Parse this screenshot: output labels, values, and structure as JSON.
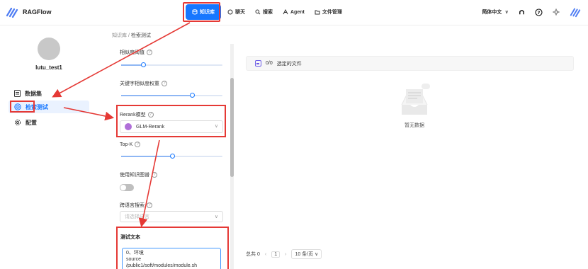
{
  "app": {
    "name": "RAGFlow"
  },
  "nav": {
    "items": [
      {
        "label": "知识库",
        "icon": "database-icon"
      },
      {
        "label": "聊天",
        "icon": "chat-icon"
      },
      {
        "label": "搜索",
        "icon": "search-icon"
      },
      {
        "label": "Agent",
        "icon": "agent-icon"
      },
      {
        "label": "文件管理",
        "icon": "folder-icon"
      }
    ]
  },
  "header": {
    "language": "简体中文"
  },
  "sidebar": {
    "kb_name": "lutu_test1",
    "items": [
      {
        "label": "数据集",
        "icon": "dataset-icon"
      },
      {
        "label": "检索测试",
        "icon": "target-icon"
      },
      {
        "label": "配置",
        "icon": "gear-icon"
      }
    ]
  },
  "breadcrumb": {
    "root": "知识库",
    "separator": "/",
    "current": "检索测试"
  },
  "settings": {
    "similarity": {
      "label": "相似度阈值",
      "value_fraction": 0.22
    },
    "keyword_weight": {
      "label": "关键字相似度权重",
      "value_fraction": 0.7
    },
    "rerank": {
      "label": "Rerank模型",
      "value": "GLM-Rerank"
    },
    "topk": {
      "label": "Top-K",
      "value_fraction": 0.5
    },
    "knowledge_graph": {
      "label": "使用知识图谱",
      "enabled": false
    },
    "cross_language": {
      "label": "跨语言搜索",
      "placeholder": "请选择语言"
    },
    "test_text": {
      "title": "测试文本",
      "lines": [
        "0、环境",
        "source",
        "/public1/soft/modules/module.sh"
      ]
    }
  },
  "results": {
    "selected": "0/0",
    "selected_label": "选定的文件",
    "empty": "暂无数据"
  },
  "pagination": {
    "total_label": "总共 0",
    "page": "1",
    "page_size": "10 条/页"
  },
  "colors": {
    "accent": "#1677ff",
    "annotation": "#e53935"
  }
}
